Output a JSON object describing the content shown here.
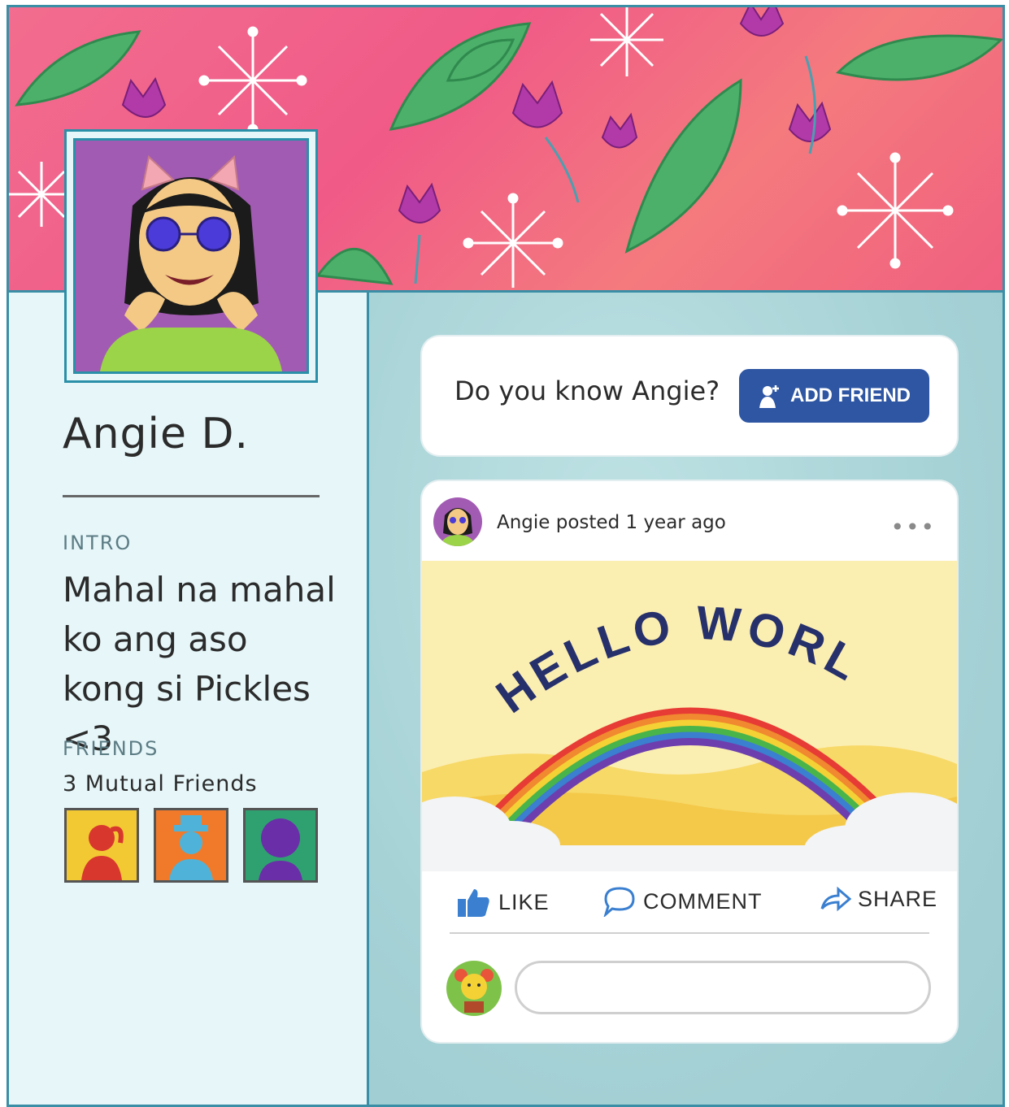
{
  "profile": {
    "name": "Angie D.",
    "intro_label": "INTRO",
    "intro_text": "Mahal na mahal ko ang aso kong si Pickles <3",
    "friends_label": "FRIENDS",
    "mutual_friends": "3 Mutual Friends"
  },
  "prompt_card": {
    "question": "Do you know Angie?",
    "add_friend_label": "ADD FRIEND"
  },
  "post": {
    "meta": "Angie posted 1 year ago",
    "more": "•••",
    "image_text": "HELLO WORLD",
    "actions": {
      "like": "LIKE",
      "comment": "COMMENT",
      "share": "SHARE"
    },
    "comment_placeholder": ""
  },
  "colors": {
    "accent": "#2e56a3",
    "border": "#3a8fa6",
    "cover_pink": "#f05a87"
  }
}
